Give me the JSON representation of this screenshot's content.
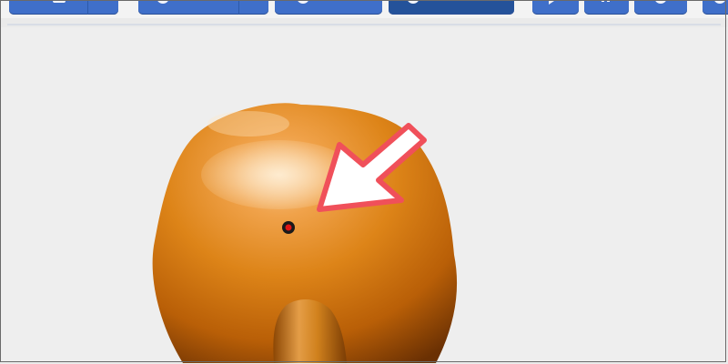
{
  "window": {
    "background": "#eeeeee"
  },
  "toolbar": {
    "accent": "#3f6fc9",
    "active_accent": "#24529a",
    "buttons": [
      {
        "name": "toolbar-button-1",
        "icon": "square-icon"
      },
      {
        "name": "toolbar-button-2",
        "icon": "rotate-icon"
      },
      {
        "name": "toolbar-button-3",
        "icon": "rotate-icon"
      },
      {
        "name": "toolbar-button-4",
        "icon": "rotate-icon",
        "active": true
      },
      {
        "name": "toolbar-button-5",
        "icon": "play-icon"
      },
      {
        "name": "toolbar-button-6",
        "icon": "pause-icon"
      },
      {
        "name": "toolbar-button-7",
        "icon": "reset-icon"
      }
    ]
  },
  "stage": {
    "object": "orange-3d-blob",
    "object_color": "#d9840f",
    "marker_color": "#e01515",
    "arrow_color": "#f0505a"
  }
}
